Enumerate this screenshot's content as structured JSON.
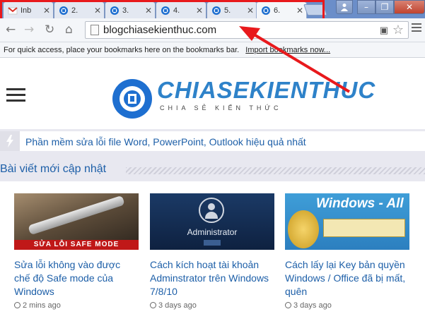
{
  "browser": {
    "tabs": [
      {
        "label": "Inb",
        "icon": "gmail-icon"
      },
      {
        "label": "2.",
        "icon": "chiasekienthuc-favicon-icon"
      },
      {
        "label": "3.",
        "icon": "chiasekienthuc-favicon-icon"
      },
      {
        "label": "4.",
        "icon": "chiasekienthuc-favicon-icon"
      },
      {
        "label": "5.",
        "icon": "chiasekienthuc-favicon-icon"
      },
      {
        "label": "6.",
        "icon": "chiasekienthuc-favicon-icon",
        "active": true
      }
    ],
    "url": "blogchiasekienthuc.com",
    "bookmarks_hint": "For quick access, place your bookmarks here on the bookmarks bar.",
    "bookmarks_link": "Import bookmarks now...",
    "highlight_color": "#e8191c"
  },
  "site": {
    "logo_text": "CHIASEKIENTHUC",
    "logo_sub": "CHIA SẺ KIẾN THỨC",
    "ticker": "Phần mềm sửa lỗi file Word, PowerPoint, Outlook hiệu quả nhất",
    "section_title": "Bài viết mới cập nhật",
    "accent_color": "#1d5fa8",
    "posts": [
      {
        "title": "Sửa lỗi không vào được chế độ Safe mode của Windows",
        "time": "2 mins ago",
        "thumb_caption": "SỬA LỖI SAFE MODE"
      },
      {
        "title": "Cách kích hoạt tài khoản Adminstrator trên Windows 7/8/10",
        "time": "3 days ago",
        "thumb_caption": "Administrator"
      },
      {
        "title": "Cách lấy lại Key bản quyền Windows / Office đã bị mất, quên",
        "time": "3 days ago",
        "thumb_caption": "Windows - All"
      }
    ]
  }
}
